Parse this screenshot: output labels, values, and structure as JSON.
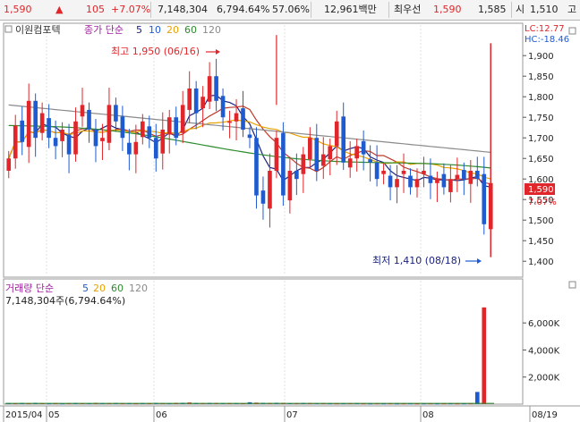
{
  "topbar": {
    "price": "1,590",
    "change_arrow": "▲",
    "change": "105",
    "change_pct": "+7.07%",
    "volume": "7,148,304",
    "volume_ratio": "6,794.64%",
    "turnover": "57.06%",
    "amount": "12,961백만",
    "best_label": "최우선",
    "ask": "1,590",
    "bid": "1,585",
    "open_label": "시",
    "open": "1,510",
    "more": "고"
  },
  "price_panel": {
    "stock_name": "이원컴포텍",
    "legend_prefix": "종가 단순",
    "ma_periods": [
      "5",
      "10",
      "20",
      "60",
      "120"
    ],
    "lc_label": "LC:12.77",
    "hc_label": "HC:-18.46",
    "high_annotation": "최고 1,950 (06/16)",
    "low_annotation": "최저 1,410 (08/18)",
    "current_price_tag": "1,590",
    "current_pct_tag": "7.07%"
  },
  "volume_panel": {
    "legend_prefix": "거래량 단순",
    "ma_periods": [
      "5",
      "20",
      "60",
      "120"
    ],
    "value_text": "7,148,304주(6,794.64%)"
  },
  "colors": {
    "up": "#e0262a",
    "down": "#1f5bd0",
    "ma5": "#1a237e",
    "ma10": "#c0392b",
    "ma20": "#e8a200",
    "ma60": "#2e8b2e",
    "ma120": "#8a8a8a"
  },
  "chart_data": {
    "type": "candlestick",
    "x_labels": [
      "2015/04",
      "05",
      "06",
      "07",
      "08",
      "08/19"
    ],
    "price_axis": {
      "ticks": [
        1400,
        1450,
        1500,
        1550,
        1600,
        1650,
        1700,
        1750,
        1800,
        1850,
        1900
      ],
      "range": [
        1370,
        1970
      ]
    },
    "volume_axis": {
      "ticks": [
        2000,
        4000,
        6000
      ],
      "tick_labels": [
        "2,000K",
        "4,000K",
        "6,000K"
      ],
      "unit": "K",
      "range": [
        0,
        7400
      ]
    },
    "ohlc_anchors": [
      1650,
      1730,
      1690,
      1790,
      1700,
      1760,
      1700,
      1680,
      1720,
      1660,
      1740,
      1780,
      1720,
      1680,
      1700,
      1780,
      1740,
      1700,
      1660,
      1690,
      1740,
      1700,
      1650,
      1720,
      1750,
      1700,
      1780,
      1820,
      1760,
      1800,
      1850,
      1790,
      1750,
      1740,
      1760,
      1720,
      1700,
      1560,
      1540,
      1620,
      1700,
      1560,
      1620,
      1600,
      1660,
      1700,
      1620,
      1660,
      1680,
      1740,
      1640,
      1650,
      1680,
      1660,
      1640,
      1600,
      1620,
      1580,
      1600,
      1620,
      1580,
      1600,
      1620,
      1590,
      1600,
      1580,
      1600,
      1610,
      1600,
      1620,
      1600,
      1490,
      1590
    ],
    "volume_values": [
      70,
      60,
      80,
      60,
      90,
      70,
      60,
      75,
      55,
      65,
      80,
      70,
      60,
      90,
      70,
      65,
      80,
      60,
      70,
      55,
      75,
      60,
      85,
      70,
      60,
      90,
      100,
      120,
      80,
      70,
      90,
      80,
      70,
      75,
      70,
      60,
      140,
      110,
      90,
      80,
      100,
      90,
      70,
      60,
      80,
      75,
      65,
      70,
      60,
      55,
      60,
      65,
      70,
      55,
      50,
      60,
      55,
      60,
      50,
      55,
      60,
      50,
      55,
      60,
      50,
      55,
      60,
      50,
      55,
      60,
      900,
      7148
    ]
  }
}
